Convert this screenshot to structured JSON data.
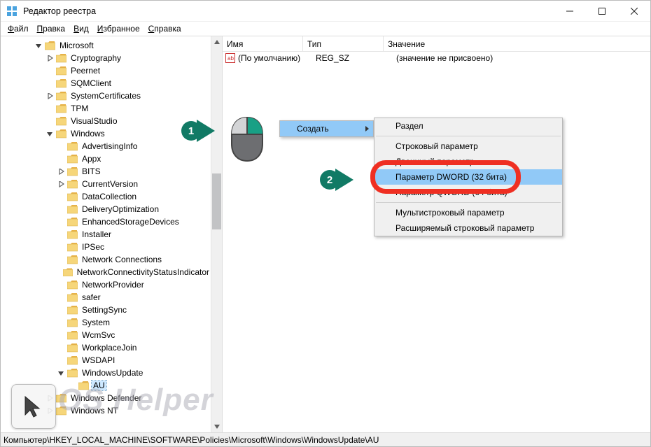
{
  "title": "Редактор реестра",
  "menu": {
    "file": "Файл",
    "edit": "Правка",
    "view": "Вид",
    "favorites": "Избранное",
    "help": "Справка"
  },
  "tree": {
    "items": [
      {
        "depth": 3,
        "exp": "down",
        "label": "Microsoft"
      },
      {
        "depth": 4,
        "exp": "right",
        "label": "Cryptography"
      },
      {
        "depth": 4,
        "exp": "none",
        "label": "Peernet"
      },
      {
        "depth": 4,
        "exp": "none",
        "label": "SQMClient"
      },
      {
        "depth": 4,
        "exp": "right",
        "label": "SystemCertificates"
      },
      {
        "depth": 4,
        "exp": "none",
        "label": "TPM"
      },
      {
        "depth": 4,
        "exp": "none",
        "label": "VisualStudio"
      },
      {
        "depth": 4,
        "exp": "down",
        "label": "Windows"
      },
      {
        "depth": 5,
        "exp": "none",
        "label": "AdvertisingInfo"
      },
      {
        "depth": 5,
        "exp": "none",
        "label": "Appx"
      },
      {
        "depth": 5,
        "exp": "right",
        "label": "BITS"
      },
      {
        "depth": 5,
        "exp": "right",
        "label": "CurrentVersion"
      },
      {
        "depth": 5,
        "exp": "none",
        "label": "DataCollection"
      },
      {
        "depth": 5,
        "exp": "none",
        "label": "DeliveryOptimization"
      },
      {
        "depth": 5,
        "exp": "none",
        "label": "EnhancedStorageDevices"
      },
      {
        "depth": 5,
        "exp": "none",
        "label": "Installer"
      },
      {
        "depth": 5,
        "exp": "none",
        "label": "IPSec"
      },
      {
        "depth": 5,
        "exp": "none",
        "label": "Network Connections"
      },
      {
        "depth": 5,
        "exp": "none",
        "label": "NetworkConnectivityStatusIndicator"
      },
      {
        "depth": 5,
        "exp": "none",
        "label": "NetworkProvider"
      },
      {
        "depth": 5,
        "exp": "none",
        "label": "safer"
      },
      {
        "depth": 5,
        "exp": "none",
        "label": "SettingSync"
      },
      {
        "depth": 5,
        "exp": "none",
        "label": "System"
      },
      {
        "depth": 5,
        "exp": "none",
        "label": "WcmSvc"
      },
      {
        "depth": 5,
        "exp": "none",
        "label": "WorkplaceJoin"
      },
      {
        "depth": 5,
        "exp": "none",
        "label": "WSDAPI"
      },
      {
        "depth": 5,
        "exp": "down",
        "label": "WindowsUpdate"
      },
      {
        "depth": 6,
        "exp": "none",
        "label": "AU",
        "selected": true
      },
      {
        "depth": 4,
        "exp": "right",
        "label": "Windows Defender"
      },
      {
        "depth": 4,
        "exp": "right",
        "label": "Windows NT"
      }
    ]
  },
  "listheader": {
    "name": "Имя",
    "type": "Тип",
    "value": "Значение"
  },
  "listrows": [
    {
      "name": "(По умолчанию)",
      "type": "REG_SZ",
      "value": "(значение не присвоено)"
    }
  ],
  "statusbar": "Компьютер\\HKEY_LOCAL_MACHINE\\SOFTWARE\\Policies\\Microsoft\\Windows\\WindowsUpdate\\AU",
  "contextmenu": {
    "create": "Создать"
  },
  "submenu": {
    "items": [
      "Раздел",
      "Строковый параметр",
      "Двоичный параметр",
      "Параметр DWORD (32 бита)",
      "Параметр QWORD (64 бита)",
      "Мультистроковый параметр",
      "Расширяемый строковый параметр"
    ],
    "highlight_index": 3
  },
  "callouts": {
    "n1": "1",
    "n2": "2"
  },
  "watermark": "OS Helper"
}
